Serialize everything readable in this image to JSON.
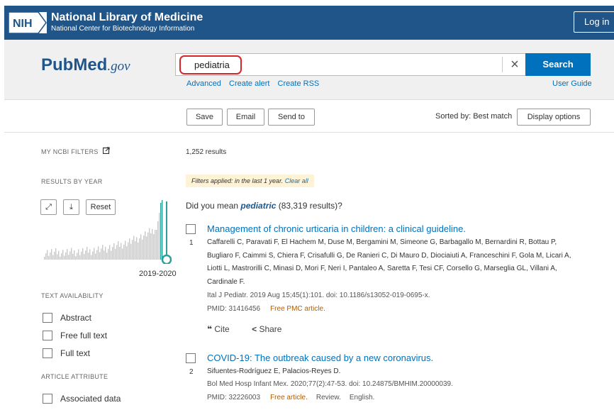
{
  "header": {
    "logo_text": "NIH",
    "title": "National Library of Medicine",
    "subtitle": "National Center for Biotechnology Information",
    "login_label": "Log in"
  },
  "brand": {
    "name_left": "Pub",
    "name_right": "Med",
    "suffix": ".gov"
  },
  "search": {
    "query": "pediatria",
    "clear_symbol": "×",
    "button_label": "Search",
    "links": [
      "Advanced",
      "Create alert",
      "Create RSS"
    ],
    "user_guide": "User Guide"
  },
  "actions": {
    "save": "Save",
    "email": "Email",
    "send_to": "Send to",
    "sorted_by": "Sorted by: Best match",
    "display_options": "Display options"
  },
  "sidebar": {
    "my_ncbi_filters": "MY NCBI FILTERS",
    "results_by_year": "RESULTS BY YEAR",
    "reset": "Reset",
    "year_range": "2019-2020",
    "text_availability": "TEXT AVAILABILITY",
    "text_options": [
      "Abstract",
      "Free full text",
      "Full text"
    ],
    "article_attribute": "ARTICLE ATTRIBUTE",
    "attribute_options": [
      "Associated data"
    ]
  },
  "results": {
    "count": "1,252 results",
    "filters_prefix": "Filters applied: in the last 1 year.",
    "clear_all": "Clear all",
    "did_you_mean_prefix": "Did you mean",
    "did_you_mean_term": "pediatric",
    "did_you_mean_suffix": "(83,319 results)?",
    "cite_label": "Cite",
    "share_label": "Share",
    "items": [
      {
        "number": "1",
        "title": "Management of chronic urticaria in children: a clinical guideline.",
        "authors": "Caffarelli C, Paravati F, El Hachem M, Duse M, Bergamini M, Simeone G, Barbagallo M, Bernardini R, Bottau P, Bugliaro F, Caimmi S, Chiera F, Crisafulli G, De Ranieri C, Di Mauro D, Diociaiuti A, Franceschini F, Gola M, Licari A, Liotti L, Mastrorilli C, Minasi D, Mori F, Neri I, Pantaleo A, Saretta F, Tesi CF, Corsello G, Marseglia GL, Villani A, Cardinale F.",
        "citation": "Ital J Pediatr. 2019 Aug 15;45(1):101. doi: 10.1186/s13052-019-0695-x.",
        "pmid": "PMID: 31416456",
        "free": "Free PMC article.",
        "extra": []
      },
      {
        "number": "2",
        "title": "COVID-19: The outbreak caused by a new coronavirus.",
        "authors": "Sifuentes-Rodríguez E, Palacios-Reyes D.",
        "citation": "Bol Med Hosp Infant Mex. 2020;77(2):47-53. doi: 10.24875/BMHIM.20000039.",
        "pmid": "PMID: 32226003",
        "free": "Free article.",
        "extra": [
          "Review.",
          "English."
        ]
      }
    ]
  },
  "colors": {
    "header_blue": "#20558a",
    "search_button": "#0071bc",
    "link_blue": "#0071bc",
    "highlight_circle": "#d9232a",
    "free_article": "#b35c00",
    "histogram_bar": "#c9c9c9",
    "histogram_selected": "#2aa198"
  }
}
